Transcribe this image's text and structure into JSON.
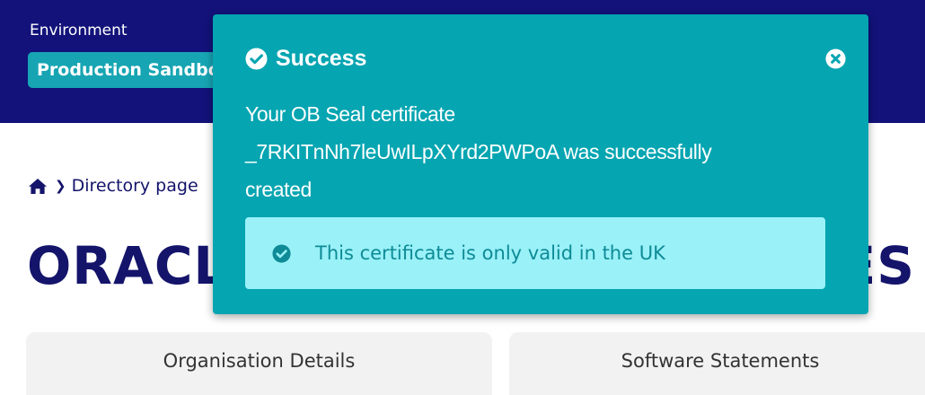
{
  "environment": {
    "label": "Environment",
    "selected": "Production Sandbox"
  },
  "breadcrumb": {
    "home_icon": "home-icon",
    "separator_icon": "chevron-right-icon",
    "item": "Directory page"
  },
  "page": {
    "title": "ORACLE FINANCIAL SERVICES UK"
  },
  "tabs": [
    {
      "label": "Organisation Details"
    },
    {
      "label": "Software Statements"
    }
  ],
  "toast": {
    "title": "Success",
    "title_icon": "check-circle-icon",
    "close_icon": "close-circle-icon",
    "message_lines": [
      "Your OB Seal certificate",
      "_7RKITnNh7leUwILpXYrd2PWPoA was successfully",
      "created"
    ],
    "notice": {
      "icon": "check-circle-icon",
      "text": "This certificate is only valid in the UK"
    }
  },
  "colors": {
    "navy": "#12127a",
    "teal_toast": "#05a5b1",
    "env_select": "#17a5b3",
    "notice_background": "#9af1f8",
    "notice_text": "#0e8b96",
    "tab_background": "#f2f2f2"
  }
}
